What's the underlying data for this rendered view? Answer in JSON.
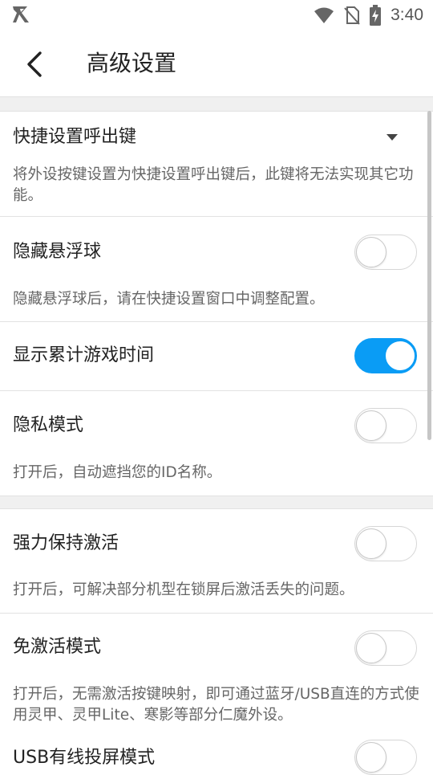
{
  "status_bar": {
    "time": "3:40"
  },
  "header": {
    "title": "高级设置",
    "back_icon": "chevron-left-icon"
  },
  "settings": {
    "hotkey": {
      "title": "快捷设置呼出键",
      "desc": "将外设按键设置为快捷设置呼出键后，此键将无法实现其它功能。"
    },
    "hide_ball": {
      "title": "隐藏悬浮球",
      "desc": "隐藏悬浮球后，请在快捷设置窗口中调整配置。",
      "enabled": false
    },
    "show_time": {
      "title": "显示累计游戏时间",
      "enabled": true
    },
    "privacy": {
      "title": "隐私模式",
      "desc": "打开后，自动遮挡您的ID名称。",
      "enabled": false
    },
    "keep_alive": {
      "title": "强力保持激活",
      "desc": "打开后，可解决部分机型在锁屏后激活丢失的问题。",
      "enabled": false
    },
    "no_activate": {
      "title": "免激活模式",
      "desc": "打开后，无需激活按键映射，即可通过蓝牙/USB直连的方式使用灵甲、灵甲Lite、寒影等部分仁魔外设。",
      "enabled": false
    },
    "usb_cast": {
      "title": "USB有线投屏模式",
      "enabled": false
    }
  },
  "colors": {
    "accent": "#0a9cf5",
    "divider": "#e2e2e2",
    "gap": "#f0f0f0"
  }
}
